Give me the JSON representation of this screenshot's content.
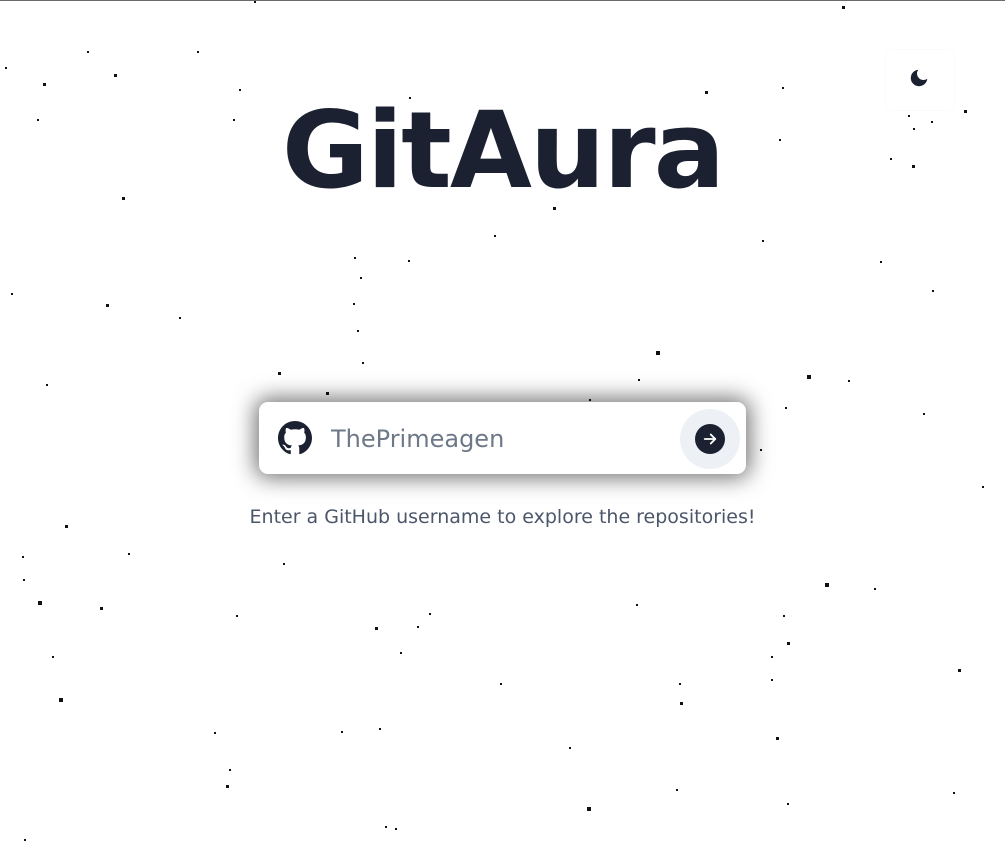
{
  "app": {
    "title": "GitAura"
  },
  "theme_toggle": {
    "icon": "moon-icon"
  },
  "search": {
    "icon": "github-icon",
    "value": "",
    "placeholder": "ThePrimeagen",
    "submit_icon": "arrow-right-icon"
  },
  "hint": {
    "text": "Enter a GitHub username to explore the repositories!"
  },
  "colors": {
    "text_dark": "#1b2130",
    "placeholder": "#6d7888",
    "hint": "#4c566a",
    "button_bg": "#edf1f5",
    "background": "#ffffff"
  }
}
